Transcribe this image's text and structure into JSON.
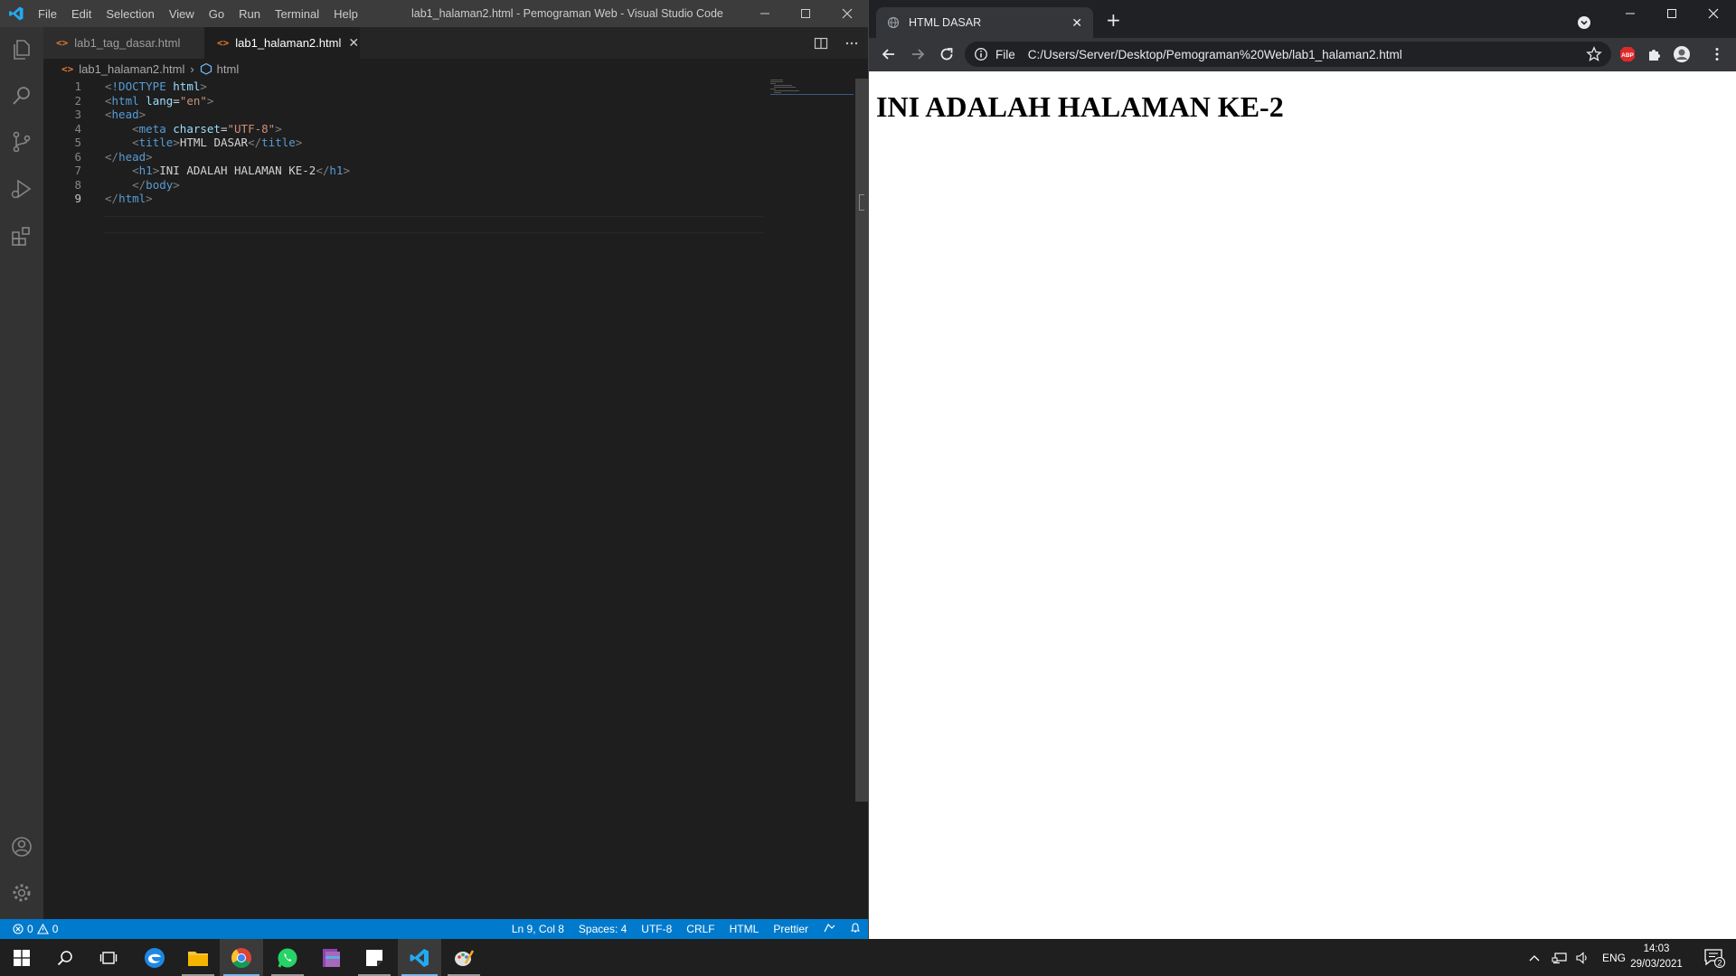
{
  "vscode": {
    "menu": [
      "File",
      "Edit",
      "Selection",
      "View",
      "Go",
      "Run",
      "Terminal",
      "Help"
    ],
    "window_title": "lab1_halaman2.html - Pemograman Web - Visual Studio Code",
    "tabs": [
      {
        "label": "lab1_tag_dasar.html",
        "active": false
      },
      {
        "label": "lab1_halaman2.html",
        "active": true
      }
    ],
    "breadcrumb": {
      "file": "lab1_halaman2.html",
      "symbol": "html"
    },
    "code_lines": [
      {
        "num": "1",
        "text": "<!DOCTYPE html>"
      },
      {
        "num": "2",
        "text": "<html lang=\"en\">"
      },
      {
        "num": "3",
        "text": "<head>"
      },
      {
        "num": "4",
        "text": "    <meta charset=\"UTF-8\">"
      },
      {
        "num": "5",
        "text": "    <title>HTML DASAR</title>"
      },
      {
        "num": "6",
        "text": "</head>"
      },
      {
        "num": "7",
        "text": "    <h1>INI ADALAH HALAMAN KE-2</h1>"
      },
      {
        "num": "8",
        "text": "    </body>"
      },
      {
        "num": "9",
        "text": "</html>"
      }
    ],
    "active_line": "9",
    "status": {
      "errors": "0",
      "warnings": "0",
      "position": "Ln 9, Col 8",
      "spaces": "Spaces: 4",
      "encoding": "UTF-8",
      "eol": "CRLF",
      "language": "HTML",
      "formatter": "Prettier"
    },
    "colors": {
      "accent": "#007acc",
      "tag": "#569cd6",
      "attr": "#9cdcfe",
      "string": "#ce9178"
    }
  },
  "chrome": {
    "tab_title": "HTML DASAR",
    "url_scheme": "File",
    "url": "C:/Users/Server/Desktop/Pemograman%20Web/lab1_halaman2.html",
    "page_heading": "INI ADALAH HALAMAN KE-2",
    "extensions": [
      "abp-icon",
      "puzzle-icon",
      "profile-icon"
    ]
  },
  "taskbar": {
    "apps": [
      "windows-start-icon",
      "search-icon",
      "task-view-icon",
      "edge-icon",
      "file-explorer-icon",
      "chrome-icon",
      "whatsapp-icon",
      "winrar-icon",
      "sticky-notes-icon",
      "vscode-icon",
      "paint-icon"
    ],
    "language": "ENG",
    "time": "14:03",
    "date": "29/03/2021",
    "notification_count": "2"
  }
}
